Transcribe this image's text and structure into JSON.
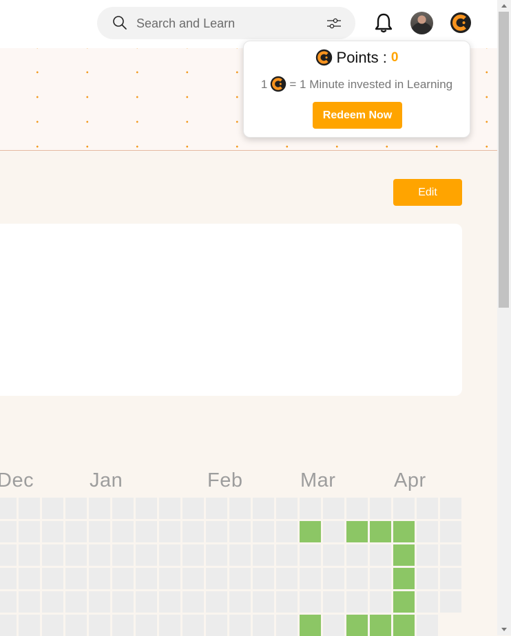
{
  "header": {
    "search": {
      "placeholder": "Search and Learn",
      "value": ""
    },
    "icons": {
      "search": "search-icon",
      "filter": "filter-icon",
      "notifications": "bell-icon",
      "profile": "avatar",
      "brand": "brand-coin-logo"
    }
  },
  "points_popup": {
    "label": "Points :",
    "value": "0",
    "rate_prefix": "1",
    "rate_text": "= 1 Minute invested in Learning",
    "redeem_label": "Redeem Now"
  },
  "profile": {
    "edit_label": "Edit"
  },
  "activity": {
    "months": [
      "Dec",
      "Jan",
      "Feb",
      "Mar",
      "Apr"
    ],
    "rows": [
      [
        0,
        0,
        0,
        0,
        0,
        0,
        0,
        0,
        0,
        0,
        0,
        0,
        0,
        0,
        0,
        0,
        0,
        0,
        0,
        0
      ],
      [
        0,
        0,
        0,
        0,
        0,
        0,
        0,
        0,
        0,
        0,
        0,
        0,
        0,
        1,
        0,
        1,
        1,
        1,
        0,
        0
      ],
      [
        0,
        0,
        0,
        0,
        0,
        0,
        0,
        0,
        0,
        0,
        0,
        0,
        0,
        0,
        0,
        0,
        0,
        1,
        0,
        0
      ],
      [
        0,
        0,
        0,
        0,
        0,
        0,
        0,
        0,
        0,
        0,
        0,
        0,
        0,
        0,
        0,
        0,
        0,
        1,
        0,
        0
      ],
      [
        0,
        0,
        0,
        0,
        0,
        0,
        0,
        0,
        0,
        0,
        0,
        0,
        0,
        0,
        0,
        0,
        0,
        1,
        0,
        0
      ],
      [
        0,
        0,
        0,
        0,
        0,
        0,
        0,
        0,
        0,
        0,
        0,
        0,
        0,
        1,
        0,
        1,
        1,
        1,
        0
      ]
    ]
  },
  "colors": {
    "accent": "#ffa400",
    "activity_on": "#8cc665",
    "activity_off": "#ececec",
    "banner_dot": "#f39a1e"
  }
}
